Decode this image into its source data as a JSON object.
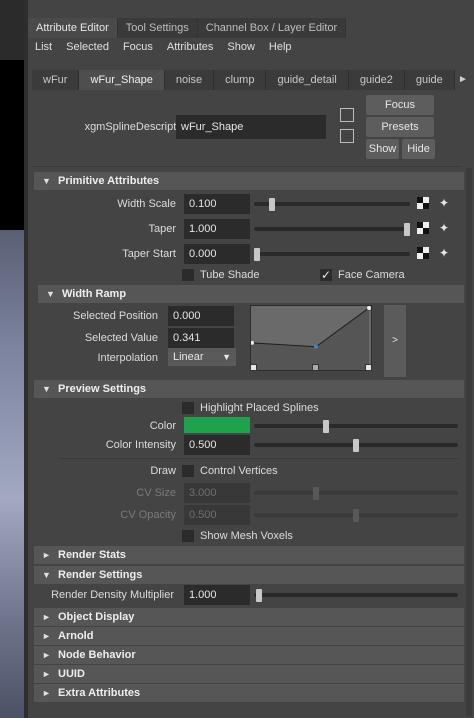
{
  "tabs": {
    "top": [
      "Attribute Editor",
      "Tool Settings",
      "Channel Box / Layer Editor"
    ],
    "menus": [
      "List",
      "Selected",
      "Focus",
      "Attributes",
      "Show",
      "Help"
    ],
    "nodes": [
      "wFur",
      "wFur_Shape",
      "noise",
      "clump",
      "guide_detail",
      "guide2",
      "guide"
    ]
  },
  "header": {
    "desc_label": "xgmSplineDescription:",
    "desc_value": "wFur_Shape",
    "focus": "Focus",
    "presets": "Presets",
    "show": "Show",
    "hide": "Hide"
  },
  "primitive": {
    "title": "Primitive Attributes",
    "width_scale_label": "Width Scale",
    "width_scale": "0.100",
    "taper_label": "Taper",
    "taper": "1.000",
    "taper_start_label": "Taper Start",
    "taper_start": "0.000",
    "tube_shade": "Tube Shade",
    "face_camera": "Face Camera",
    "sliders": {
      "width_scale": 0.1,
      "taper": 1.0,
      "taper_start": 0.0
    }
  },
  "width_ramp": {
    "title": "Width Ramp",
    "selected_position_label": "Selected Position",
    "selected_position": "0.000",
    "selected_value_label": "Selected Value",
    "selected_value": "0.341",
    "interpolation_label": "Interpolation",
    "interpolation": "Linear",
    "expand": ">"
  },
  "preview": {
    "title": "Preview Settings",
    "highlight": "Highlight Placed Splines",
    "color_label": "Color",
    "color_hex": "#1ea24c",
    "color_intensity_label": "Color Intensity",
    "color_intensity": "0.500",
    "draw_label": "Draw",
    "control_vertices": "Control Vertices",
    "cv_size_label": "CV Size",
    "cv_size": "3.000",
    "cv_opacity_label": "CV Opacity",
    "cv_opacity": "0.500",
    "show_mesh_voxels": "Show Mesh Voxels",
    "sliders": {
      "color": 0.35,
      "color_intensity": 0.5,
      "cv_size": 0.3,
      "cv_opacity": 0.5
    }
  },
  "sections": {
    "render_stats": "Render Stats",
    "render_settings": "Render Settings",
    "render_density_label": "Render Density Multiplier",
    "render_density": "1.000",
    "object_display": "Object Display",
    "arnold": "Arnold",
    "node_behavior": "Node Behavior",
    "uuid": "UUID",
    "extra_attributes": "Extra Attributes"
  }
}
